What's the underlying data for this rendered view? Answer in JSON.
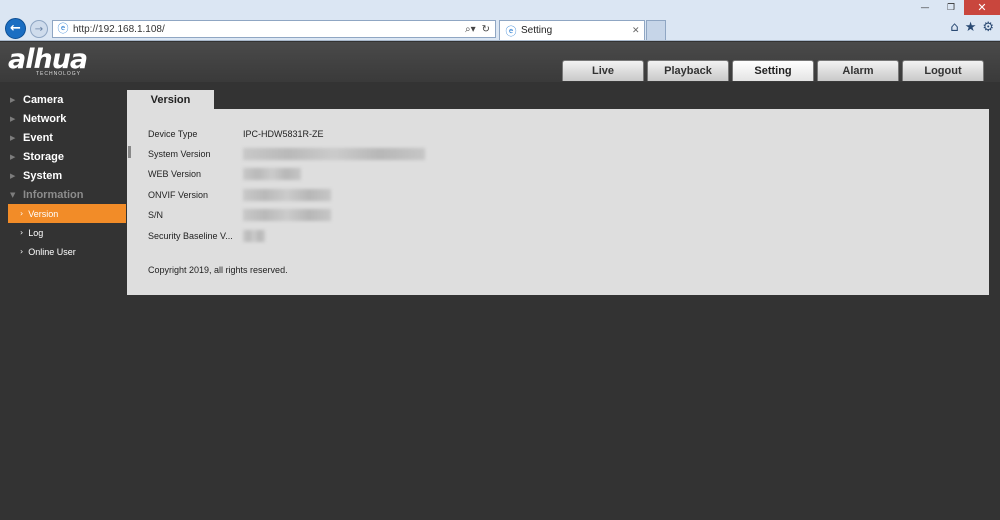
{
  "browser": {
    "url": "http://192.168.1.108/",
    "tab_title": "Setting",
    "window_controls": [
      "minimize-icon",
      "restore-icon",
      "close-icon"
    ],
    "toolbar_icons": [
      "home-icon",
      "star-icon",
      "gear-icon"
    ]
  },
  "header": {
    "logo": "alhua",
    "logo_sub": "TECHNOLOGY",
    "nav": [
      {
        "label": "Live"
      },
      {
        "label": "Playback"
      },
      {
        "label": "Setting",
        "active": true
      },
      {
        "label": "Alarm"
      },
      {
        "label": "Logout"
      }
    ]
  },
  "sidebar": {
    "items": [
      {
        "label": "Camera"
      },
      {
        "label": "Network"
      },
      {
        "label": "Event"
      },
      {
        "label": "Storage"
      },
      {
        "label": "System"
      },
      {
        "label": "Information",
        "expanded": true
      }
    ],
    "sub_items": [
      {
        "label": "Version",
        "active": true
      },
      {
        "label": "Log"
      },
      {
        "label": "Online User"
      }
    ]
  },
  "panel": {
    "tab": "Version",
    "rows": [
      {
        "label": "Device Type",
        "value": "IPC-HDW5831R-ZE"
      },
      {
        "label": "System Version",
        "value": ""
      },
      {
        "label": "WEB Version",
        "value": ""
      },
      {
        "label": "ONVIF Version",
        "value": ""
      },
      {
        "label": "S/N",
        "value": ""
      },
      {
        "label": "Security Baseline V...",
        "value": ""
      }
    ],
    "copyright": "Copyright 2019, all rights reserved."
  },
  "colors": {
    "accent": "#f28c28",
    "background": "#333333",
    "panel": "#dedede"
  }
}
